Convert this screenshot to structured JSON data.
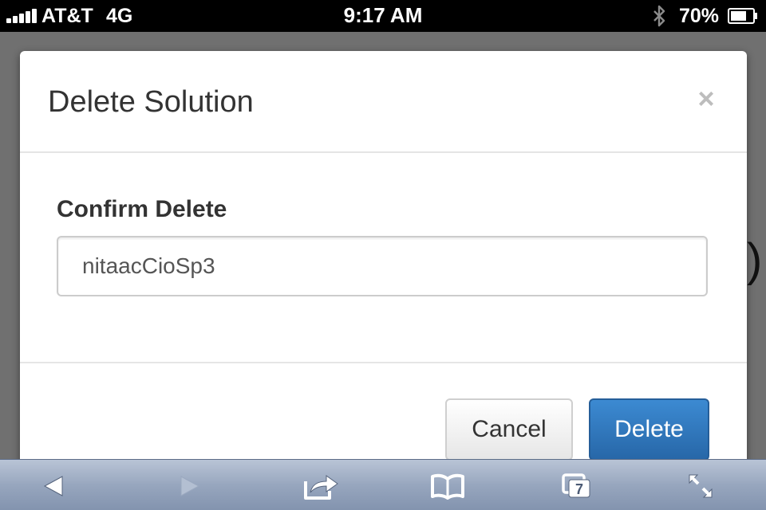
{
  "status_bar": {
    "carrier": "AT&T",
    "network": "4G",
    "time": "9:17 AM",
    "battery_percent": "70%",
    "battery_level": 0.7,
    "bluetooth_icon": "bluetooth-icon",
    "signal_icon": "signal-bars-icon"
  },
  "background_page": {
    "visible_fragment": ")"
  },
  "modal": {
    "title": "Delete Solution",
    "close_label": "×",
    "field_label": "Confirm Delete",
    "input_value": "nitaacCioSp3",
    "cancel_label": "Cancel",
    "delete_label": "Delete",
    "primary_color": "#2f78c0"
  },
  "toolbar": {
    "items": [
      "back-icon",
      "forward-icon",
      "share-icon",
      "bookmarks-icon",
      "tabs-icon",
      "fullscreen-icon"
    ],
    "tabs_count": "7"
  }
}
